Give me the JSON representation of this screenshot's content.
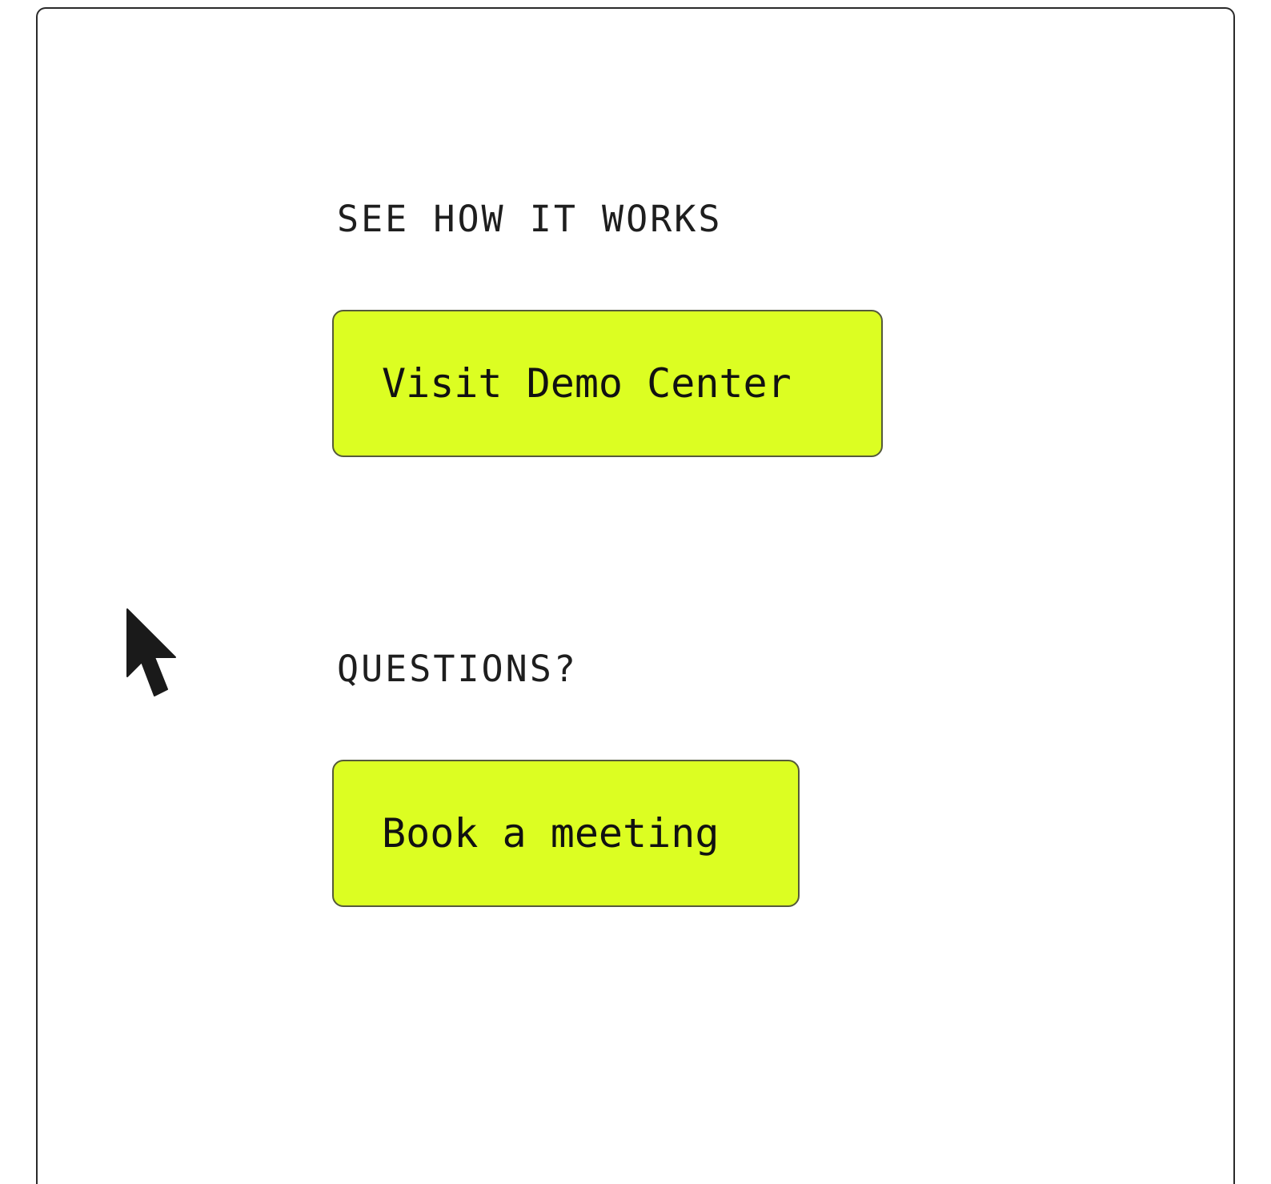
{
  "sections": [
    {
      "label": "SEE HOW IT WORKS",
      "button_label": "Visit Demo Center"
    },
    {
      "label": "QUESTIONS?",
      "button_label": "Book a meeting"
    }
  ],
  "colors": {
    "button_background": "#dcfe22",
    "text": "#1e1e1e",
    "border": "#2a2a2a"
  },
  "icons": {
    "cursor": "mouse-pointer-icon"
  }
}
